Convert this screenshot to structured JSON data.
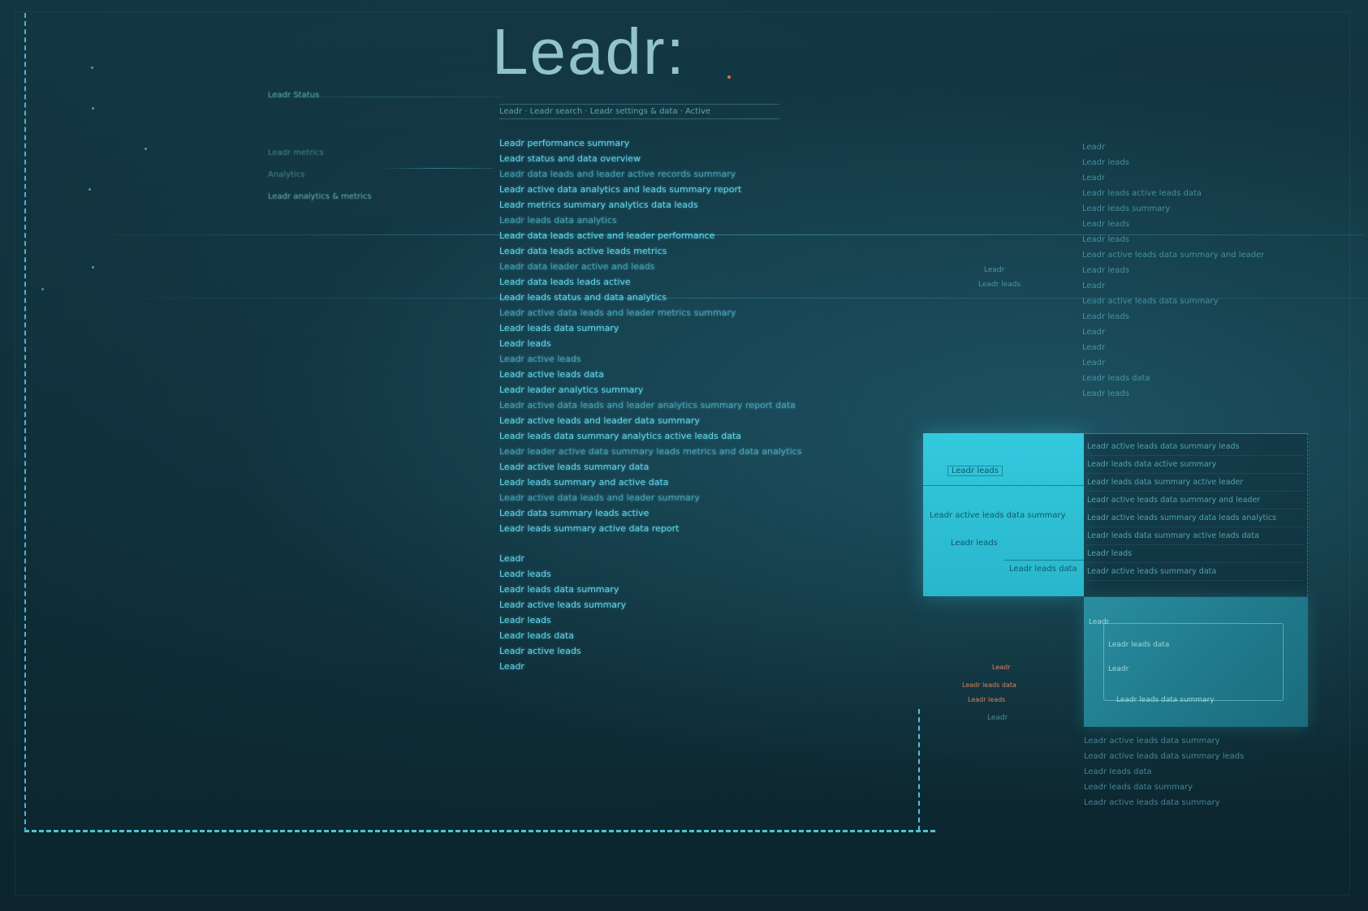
{
  "app": {
    "title": "Leadr:"
  },
  "colors": {
    "background": "#123642",
    "accent": "#33c9de",
    "frame": "#4cc3d8",
    "text": "#62d2e6",
    "warning": "#d58460"
  },
  "sidebar": {
    "items": [
      {
        "label": "Leadr Status"
      },
      {
        "label": "Leadr metrics"
      },
      {
        "label": "Analytics"
      },
      {
        "label": "Leadr analytics & metrics"
      }
    ]
  },
  "document": {
    "header": "Leadr · Leadr search · Leadr settings & data · Active",
    "lines": [
      "Leadr performance summary",
      "Leadr status and data overview",
      "Leadr data leads and leader active records summary",
      "Leadr active data analytics and leads summary report",
      "Leadr metrics summary analytics data leads",
      "Leadr leads data analytics",
      "Leadr data leads active and leader performance",
      "Leadr data leads active leads metrics",
      "Leadr data leader active and leads",
      "Leadr data leads leads active",
      "Leadr leads status and data analytics",
      "Leadr active data leads and leader metrics summary",
      "Leadr leads data summary",
      "Leadr leads",
      "Leadr active leads",
      "Leadr active leads data",
      "Leadr leader analytics summary",
      "Leadr active data leads and leader analytics summary report data",
      "Leadr active leads and leader data summary",
      "Leadr leads data summary analytics active leads data",
      "Leadr leader active data summary leads metrics and data analytics",
      "Leadr active leads summary data",
      "Leadr leads summary and active data",
      "Leadr active data leads and leader summary",
      "Leadr data summary leads active",
      "Leadr leads summary active data report"
    ],
    "footer_lines": [
      "Leadr",
      "Leadr leads",
      "Leadr leads data summary",
      "Leadr active leads summary",
      "Leadr leads",
      "Leadr leads data",
      "Leadr active leads",
      "Leadr"
    ]
  },
  "right_column": {
    "items": [
      "Leadr",
      "Leadr leads",
      "Leadr",
      "Leadr leads active leads data",
      "Leadr leads summary",
      "Leadr leads",
      "Leadr leads",
      "Leadr active leads data summary and leader",
      "Leadr leads",
      "Leadr",
      "Leadr active leads data summary",
      "Leadr leads",
      "Leadr",
      "Leadr",
      "Leadr",
      "Leadr leads data",
      "Leadr leads"
    ]
  },
  "bright_panel": {
    "title": "Leadr leads",
    "line1": "Leadr active leads data summary",
    "line2": "Leadr leads",
    "line3": "Leadr leads data"
  },
  "table_panel": {
    "rows": [
      "Leadr active leads data summary leads",
      "Leadr leads data active summary",
      "Leadr leads data summary active leader",
      "Leadr active leads data summary and leader",
      "Leadr active leads summary data leads analytics",
      "Leadr leads data summary active leads data",
      "Leadr leads",
      "Leadr active leads summary data"
    ]
  },
  "teal_panel": {
    "label1": "Leadr",
    "label2": "Leadr leads data",
    "label3": "Leadr",
    "label4": "Leadr leads data summary"
  },
  "floating": {
    "mid1": "Leadr",
    "mid2": "Leadr leads",
    "warn1": "Leadr",
    "warn2": "Leadr leads data",
    "warn3": "Leadr leads",
    "warn4": "Leadr"
  },
  "below_right": {
    "items": [
      "Leadr active leads data summary",
      "Leadr active leads data summary leads",
      "Leadr leads data",
      "Leadr leads data summary",
      "Leadr active leads data summary"
    ]
  }
}
